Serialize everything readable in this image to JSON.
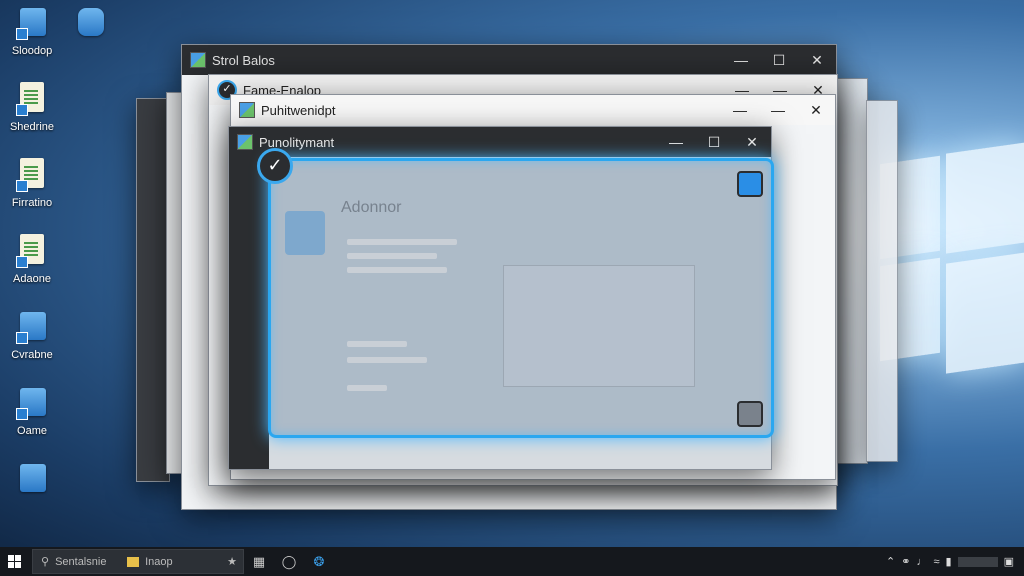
{
  "desktop": {
    "icons": [
      {
        "label": "Sloodop"
      },
      {
        "label": ""
      },
      {
        "label": "Shedrine"
      },
      {
        "label": "Firratino"
      },
      {
        "label": "Adaone"
      },
      {
        "label": "Cvrabne"
      },
      {
        "label": "Oame"
      },
      {
        "label": ""
      }
    ]
  },
  "windows": {
    "back": {
      "title": "Strol Balos"
    },
    "second": {
      "title": "Fame-Enalop"
    },
    "third": {
      "title": "Puhitwenidpt"
    },
    "front": {
      "title": "Punolitymant",
      "ghost_heading": "Adonnor"
    }
  },
  "taskbar": {
    "search_text": "Sentalsnie",
    "search_tab": "Inaop"
  },
  "colors": {
    "selection_accent": "#2aa7f0",
    "titlebar_dark": "#2b2d30",
    "taskbar": "#15181d"
  }
}
